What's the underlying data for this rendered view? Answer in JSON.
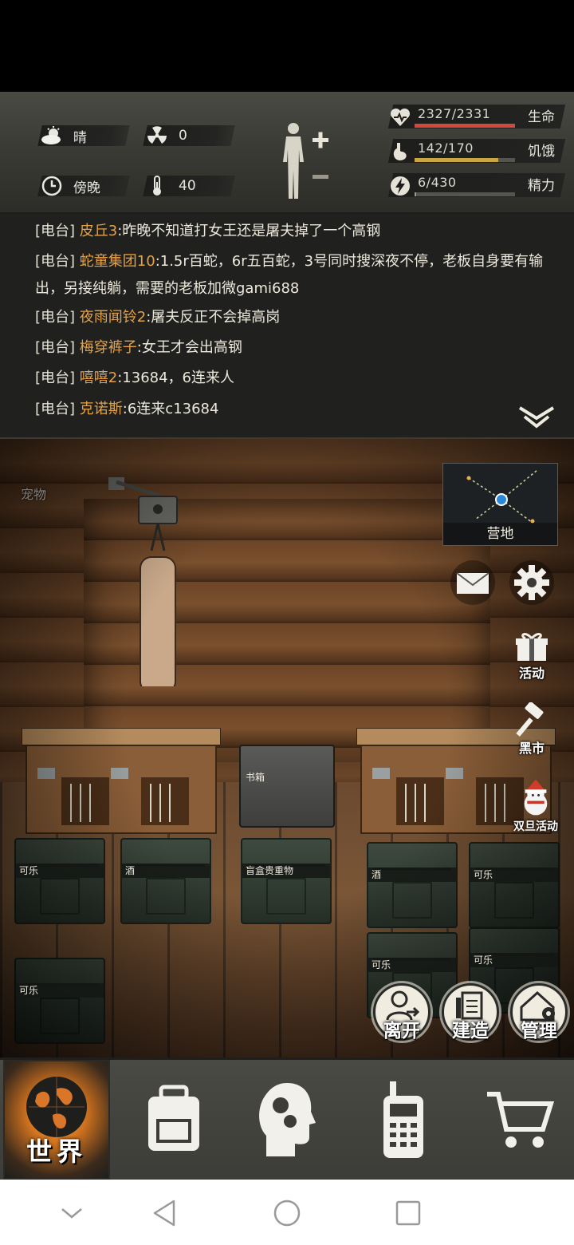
{
  "status": {
    "weather": "晴",
    "radiation": "0",
    "time_of_day": "傍晚",
    "temperature": "40",
    "vitals": {
      "health": {
        "text": "2327/2331",
        "label": "生命",
        "fraction": 0.998,
        "color": "#d04a3c"
      },
      "hunger": {
        "text": "142/170",
        "label": "饥饿",
        "fraction": 0.835,
        "color": "#c9a544"
      },
      "energy": {
        "text": "6/430",
        "label": "精力",
        "fraction": 0.014,
        "color": "#9a9a94"
      }
    }
  },
  "chat": {
    "messages": [
      {
        "tag": "[电台]",
        "user": "皮丘3",
        "text": ":昨晚不知道打女王还是屠夫掉了一个高钢"
      },
      {
        "tag": "[电台]",
        "user": "蛇童集团10",
        "text": ":1.5r百蛇，6r五百蛇，3号同时搜深夜不停，老板自身要有输出，另接纯躺，需要的老板加微gami688"
      },
      {
        "tag": "[电台]",
        "user": "夜雨闻铃2",
        "text": ":屠夫反正不会掉高岗"
      },
      {
        "tag": "[电台]",
        "user": "梅穿裤子",
        "text": ":女王才会出高钢"
      },
      {
        "tag": "[电台]",
        "user": "嘻嘻2",
        "text": ":13684，6连来人"
      },
      {
        "tag": "[电台]",
        "user": "克诺斯",
        "text": ":6连来c13684"
      }
    ]
  },
  "scene": {
    "pet_label": "宠物",
    "map_label": "营地",
    "activity_label": "活动",
    "blackmarket_label": "黑市",
    "xmas_label": "双旦活动",
    "bookbox_label": "书箱",
    "crates": [
      {
        "label": "可乐"
      },
      {
        "label": "酒"
      },
      {
        "label": "盲盒贵重物"
      },
      {
        "label": "酒"
      },
      {
        "label": "可乐"
      },
      {
        "label": "可乐"
      },
      {
        "label": "可乐"
      },
      {
        "label": "可乐"
      }
    ],
    "actions": {
      "leave": "离开",
      "build": "建造",
      "manage": "管理"
    }
  },
  "nav": {
    "world": "世界"
  },
  "colors": {
    "accent_orange": "#e3a24a",
    "health_bar": "#d04a3c",
    "hunger_bar": "#c9a544"
  },
  "icons": [
    "weather-sunny-icon",
    "radiation-icon",
    "clock-icon",
    "thermometer-icon",
    "heart-icon",
    "stomach-icon",
    "lightning-icon",
    "mail-icon",
    "gear-icon",
    "gift-icon",
    "gavel-icon",
    "backpack-icon",
    "head-gears-icon",
    "walkie-talkie-icon",
    "cart-icon"
  ]
}
